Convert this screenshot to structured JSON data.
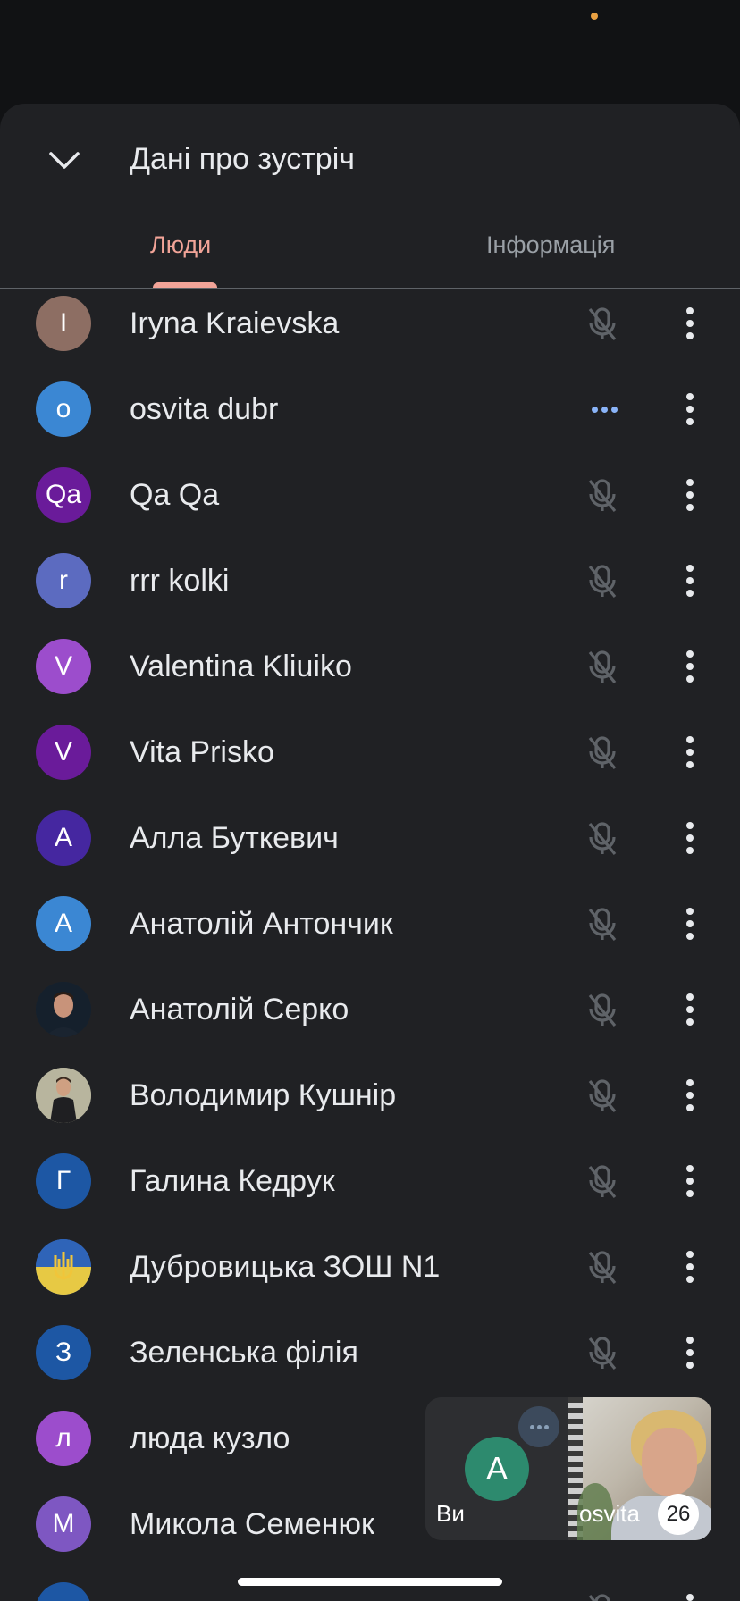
{
  "sheet": {
    "title": "Дані про зустріч",
    "tabs": [
      {
        "label": "Люди",
        "active": true
      },
      {
        "label": "Інформація",
        "active": false
      }
    ]
  },
  "participants": [
    {
      "name": "Iryna Kraievska",
      "initial": "I",
      "avatar_color": "#8d6e63",
      "status": "muted"
    },
    {
      "name": "osvita dubr",
      "initial": "o",
      "avatar_color": "#3b87d3",
      "status": "connecting"
    },
    {
      "name": "Qa Qa",
      "initial": "Qa",
      "avatar_color": "#6a1b9a",
      "status": "muted"
    },
    {
      "name": "rrr kolki",
      "initial": "r",
      "avatar_color": "#5c6bc0",
      "status": "muted"
    },
    {
      "name": "Valentina Kliuiko",
      "initial": "V",
      "avatar_color": "#9c4dcc",
      "status": "muted"
    },
    {
      "name": "Vita Prisko",
      "initial": "V",
      "avatar_color": "#6a1b9a",
      "status": "muted"
    },
    {
      "name": "Алла Буткевич",
      "initial": "А",
      "avatar_color": "#4527a0",
      "status": "muted"
    },
    {
      "name": "Анатолій Антончик",
      "initial": "А",
      "avatar_color": "#3b87d3",
      "status": "muted"
    },
    {
      "name": "Анатолій Серко",
      "initial": "",
      "avatar_color": "#1c2a3a",
      "status": "muted",
      "photo": "portrait"
    },
    {
      "name": "Володимир Кушнір",
      "initial": "",
      "avatar_color": "#8a8f7a",
      "status": "muted",
      "photo": "portrait-light"
    },
    {
      "name": "Галина Кедрук",
      "initial": "Г",
      "avatar_color": "#1d57a4",
      "status": "muted"
    },
    {
      "name": "Дубровицька ЗОШ N1",
      "initial": "",
      "avatar_color": "#2f64b8",
      "status": "muted",
      "photo": "trident"
    },
    {
      "name": "Зеленська філія",
      "initial": "З",
      "avatar_color": "#1d57a4",
      "status": "muted"
    },
    {
      "name": "люда кузло",
      "initial": "л",
      "avatar_color": "#9c4dcc",
      "status": "hidden"
    },
    {
      "name": "Микола Семенюк",
      "initial": "М",
      "avatar_color": "#7e57c2",
      "status": "hidden"
    },
    {
      "name": "",
      "initial": "",
      "avatar_color": "#1d57a4",
      "status": "muted"
    }
  ],
  "pip": {
    "self_label": "Ви",
    "self_initial": "А",
    "remote_label": "osvita",
    "participant_count": "26"
  },
  "icons": {
    "collapse": "chevron-down-icon",
    "mic_off": "mic-off-icon",
    "more": "more-vert-icon"
  }
}
